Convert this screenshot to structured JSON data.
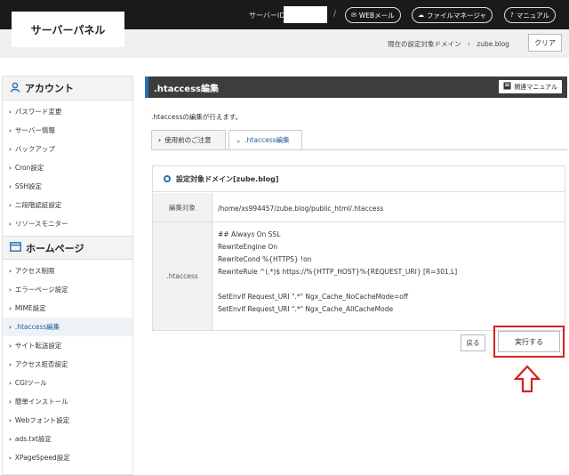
{
  "header": {
    "logo_text": "サーバーパネル",
    "server_id_label": "サーバーID",
    "separator": "/",
    "buttons": [
      {
        "icon": "globe-icon",
        "glyph": "✉",
        "label": "WEBメール"
      },
      {
        "icon": "cloud-icon",
        "glyph": "☁",
        "label": "ファイルマネージャ"
      },
      {
        "icon": "help-icon",
        "glyph": "?",
        "label": "マニュアル"
      }
    ]
  },
  "subbar": {
    "current_domain_label": "現在の設定対象ドメイン",
    "arrow": "›",
    "current_domain": "zube.blog",
    "clear_label": "クリア"
  },
  "sidebar": {
    "sections": [
      {
        "title": "アカウント",
        "icon": "user-icon",
        "items": [
          "パスワード変更",
          "サーバー情報",
          "バックアップ",
          "Cron設定",
          "SSH設定",
          "二段階認証設定",
          "リソースモニター"
        ]
      },
      {
        "title": "ホームページ",
        "icon": "window-icon",
        "items": [
          "アクセス制限",
          "エラーページ設定",
          "MIME設定",
          ".htaccess編集",
          "サイト転送設定",
          "アクセス拒否設定",
          "CGIツール",
          "簡単インストール",
          "Webフォント設定",
          "ads.txt設定",
          "XPageSpeed設定"
        ]
      }
    ],
    "active_item": ".htaccess編集"
  },
  "main": {
    "title": ".htaccess編集",
    "manual_label": "関連マニュアル",
    "description": ".htaccessの編集が行えます。",
    "tabs": [
      {
        "label": "使用前のご注意",
        "chev": "›"
      },
      {
        "label": ".htaccess編集",
        "chev": "⌄"
      }
    ],
    "target_domain_label": "設定対象ドメイン[zube.blog]",
    "rows": {
      "target_label": "編集対象",
      "target_value": "/home/xs994457/zube.blog/public_html/.htaccess",
      "htaccess_label": ".htaccess",
      "code_lines": [
        "## Always On SSL",
        "RewriteEngine On",
        "RewriteCond %{HTTPS} !on",
        "RewriteRule ^(.*)$ https://%{HTTP_HOST}%{REQUEST_URI} [R=301,L]",
        "",
        "SetEnvIf Request_URI \".*\" Ngx_Cache_NoCacheMode=off",
        "SetEnvIf Request_URI \".*\" Ngx_Cache_AllCacheMode"
      ]
    },
    "back_label": "戻る",
    "execute_label": "実行する"
  },
  "colors": {
    "accent": "#2a6fb0",
    "highlight": "#d62020",
    "topbar": "#1a1a1a"
  }
}
